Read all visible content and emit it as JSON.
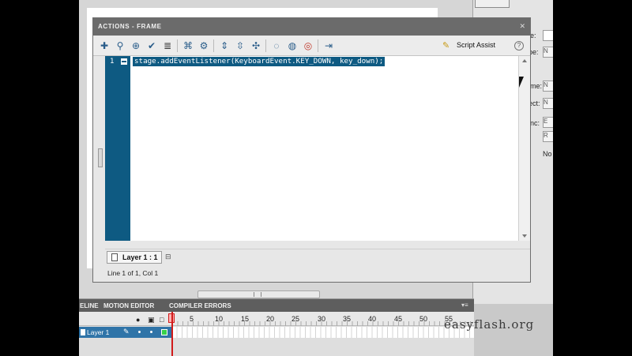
{
  "panel": {
    "title": "ACTIONS - FRAME",
    "close_glyph": "✕",
    "menu_glyph": "▾≡"
  },
  "toolbar": {
    "script_assist_label": "Script Assist",
    "help_glyph": "?",
    "icons": [
      "add-statement-icon",
      "find-icon",
      "target-path-icon",
      "check-syntax-icon",
      "auto-format-icon",
      "code-hint-icon",
      "debug-options-icon",
      "collapse-between-braces-icon",
      "collapse-selection-icon",
      "expand-all-icon",
      "apply-block-comment-icon",
      "apply-line-comment-icon",
      "remove-comment-icon",
      "show-hide-toolbox-icon"
    ]
  },
  "editor": {
    "line_number": "1",
    "code": "stage.addEventListener(KeyboardEvent.KEY_DOWN, key_down);"
  },
  "layer_tab": {
    "label": "Layer 1 : 1"
  },
  "status": {
    "text": "Line 1 of 1, Col 1"
  },
  "timeline": {
    "tabs": [
      "ELINE",
      "MOTION EDITOR",
      "COMPILER ERRORS"
    ],
    "frame_numbers": [
      "5",
      "10",
      "15",
      "20",
      "25",
      "30",
      "35",
      "40",
      "45",
      "50",
      "55"
    ],
    "layer_name": "Layer 1"
  },
  "right_panel": {
    "labels": [
      "e:",
      "pe:",
      "me:",
      "ect:",
      "inc:",
      "No"
    ],
    "fields": [
      "",
      "N",
      "N",
      "N",
      "E",
      "R"
    ]
  },
  "watermark": "easyflash.org",
  "colors": {
    "selection": "#0e5a82",
    "gutter": "#0e5a82",
    "timeline_selected": "#2f74a8",
    "playhead": "#d11a1a"
  }
}
